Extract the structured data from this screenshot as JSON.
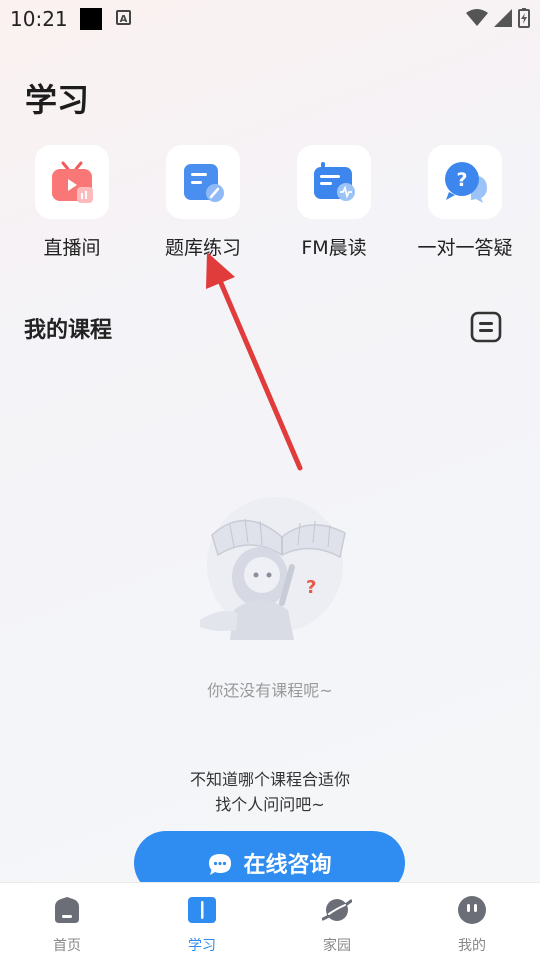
{
  "status": {
    "time": "10:21"
  },
  "page": {
    "title": "学习"
  },
  "quick": [
    {
      "label": "直播间",
      "icon": "tv-live-icon"
    },
    {
      "label": "题库练习",
      "icon": "question-bank-icon"
    },
    {
      "label": "FM晨读",
      "icon": "radio-icon"
    },
    {
      "label": "一对一答疑",
      "icon": "chat-question-icon"
    }
  ],
  "courses": {
    "title": "我的课程",
    "empty_text": "你还没有课程呢~",
    "hint_line1": "不知道哪个课程合适你",
    "hint_line2": "找个人问问吧~",
    "consult_label": "在线咨询"
  },
  "tabs": [
    {
      "label": "首页",
      "icon": "home-icon",
      "active": false
    },
    {
      "label": "学习",
      "icon": "book-icon",
      "active": true
    },
    {
      "label": "家园",
      "icon": "planet-icon",
      "active": false
    },
    {
      "label": "我的",
      "icon": "profile-icon",
      "active": false
    }
  ],
  "colors": {
    "accent": "#2f8cf0",
    "arrow": "#e03c3c",
    "live": "#f25b5b"
  }
}
